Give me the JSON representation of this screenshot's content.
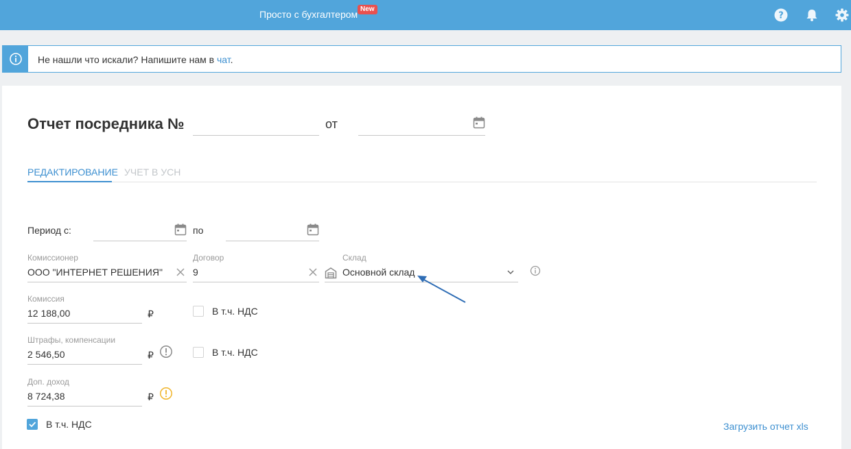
{
  "header": {
    "promo_text": "Просто с бухгалтером",
    "badge": "New",
    "icons": [
      "help-icon",
      "bell-icon",
      "gear-icon"
    ]
  },
  "info": {
    "text": "Не нашли что искали? Напишите нам в ",
    "link": "чат",
    "suffix": "."
  },
  "doc": {
    "title": "Отчет посредника №",
    "number_value": "",
    "from_label": "от",
    "date_value": ""
  },
  "tabs": [
    {
      "label": "РЕДАКТИРОВАНИЕ",
      "active": true
    },
    {
      "label": "УЧЕТ В УСН",
      "active": false
    }
  ],
  "period": {
    "label": "Период с:",
    "to_label": "по",
    "from_value": "",
    "to_value": ""
  },
  "fields": {
    "commissioner": {
      "label": "Комиссионер",
      "value": "ООО \"ИНТЕРНЕТ РЕШЕНИЯ\""
    },
    "contract": {
      "label": "Договор",
      "value": "9"
    },
    "warehouse": {
      "label": "Склад",
      "value": "Основной склад"
    },
    "commission": {
      "label": "Комиссия",
      "value": "12 188,00",
      "currency": "₽",
      "vat_label": "В т.ч. НДС",
      "vat_checked": false
    },
    "fines": {
      "label": "Штрафы, компенсации",
      "value": "2 546,50",
      "currency": "₽",
      "vat_label": "В т.ч. НДС",
      "vat_checked": false
    },
    "extra_income": {
      "label": "Доп. доход",
      "value": "8 724,38",
      "currency": "₽"
    }
  },
  "vat_total": {
    "label": "В т.ч. НДС",
    "checked": true
  },
  "upload_link": "Загрузить отчет xls",
  "colors": {
    "header": "#51a5db",
    "accent": "#3c8fd0",
    "badge": "#e8514f",
    "warning": "#f0b429"
  }
}
